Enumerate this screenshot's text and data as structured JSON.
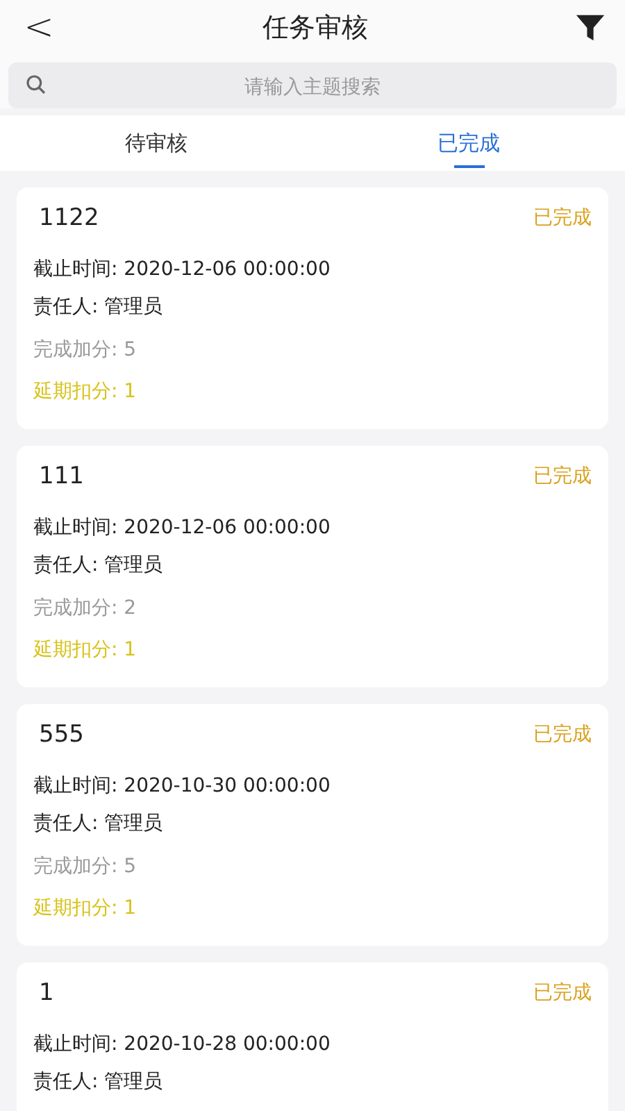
{
  "header": {
    "back": "<",
    "title": "任务审核"
  },
  "search": {
    "placeholder": "请输入主题搜索"
  },
  "tabs": [
    {
      "label": "待审核",
      "selected": false
    },
    {
      "label": "已完成",
      "selected": true
    }
  ],
  "tasks": [
    {
      "title": "1122",
      "status": "已完成",
      "deadline": "截止时间: 2020-12-06 00:00:00",
      "owner": "责任人: 管理员",
      "bonus": "完成加分: 5",
      "penalty": "延期扣分: 1"
    },
    {
      "title": "111",
      "status": "已完成",
      "deadline": "截止时间: 2020-12-06 00:00:00",
      "owner": "责任人: 管理员",
      "bonus": "完成加分: 2",
      "penalty": "延期扣分: 1"
    },
    {
      "title": "555",
      "status": "已完成",
      "deadline": "截止时间: 2020-10-30 00:00:00",
      "owner": "责任人: 管理员",
      "bonus": "完成加分: 5",
      "penalty": "延期扣分: 1"
    },
    {
      "title": "1",
      "status": "已完成",
      "deadline": "截止时间: 2020-10-28 00:00:00",
      "owner": "责任人: 管理员"
    }
  ]
}
